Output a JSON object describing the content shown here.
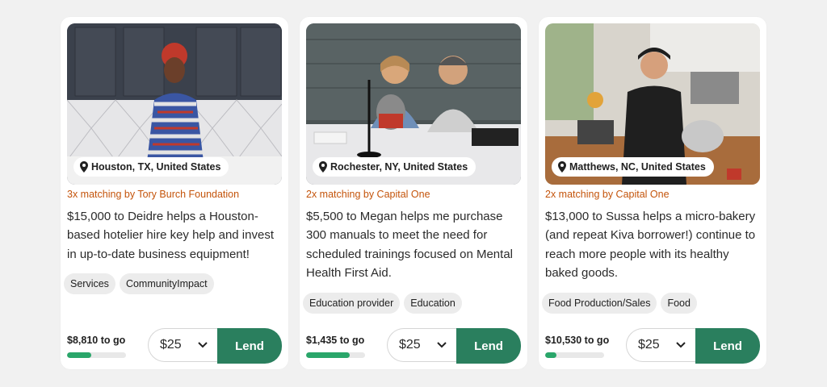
{
  "cards": [
    {
      "location": "Houston, TX, United States",
      "matching": "3x matching by Tory Burch Foundation",
      "description": "$15,000 to Deidre helps a Houston-based hotelier hire key help and invest in up-to-date business equipment!",
      "tags": [
        "Services",
        "CommunityImpact"
      ],
      "to_go": "$8,810 to go",
      "progress": 0.41,
      "amount": "$25",
      "lend_label": "Lend",
      "photo_icon": "borrower-photo"
    },
    {
      "location": "Rochester, NY, United States",
      "matching": "2x matching by Capital One",
      "description": "$5,500 to Megan helps me purchase 300 manuals to meet the need for scheduled trainings focused on Mental Health First Aid.",
      "tags": [
        "Education provider",
        "Education"
      ],
      "to_go": "$1,435 to go",
      "progress": 0.74,
      "amount": "$25",
      "lend_label": "Lend",
      "photo_icon": "borrower-photo"
    },
    {
      "location": "Matthews, NC, United States",
      "matching": "2x matching by Capital One",
      "description": "$13,000 to Sussa helps a micro-bakery (and repeat Kiva borrower!) continue to reach more people with its healthy baked goods.",
      "tags": [
        "Food Production/Sales",
        "Food"
      ],
      "to_go": "$10,530 to go",
      "progress": 0.19,
      "amount": "$25",
      "lend_label": "Lend",
      "photo_icon": "borrower-photo"
    }
  ],
  "colors": {
    "match": "#c4540b",
    "lend": "#2a7f5e",
    "progress": "#2aa66a"
  }
}
